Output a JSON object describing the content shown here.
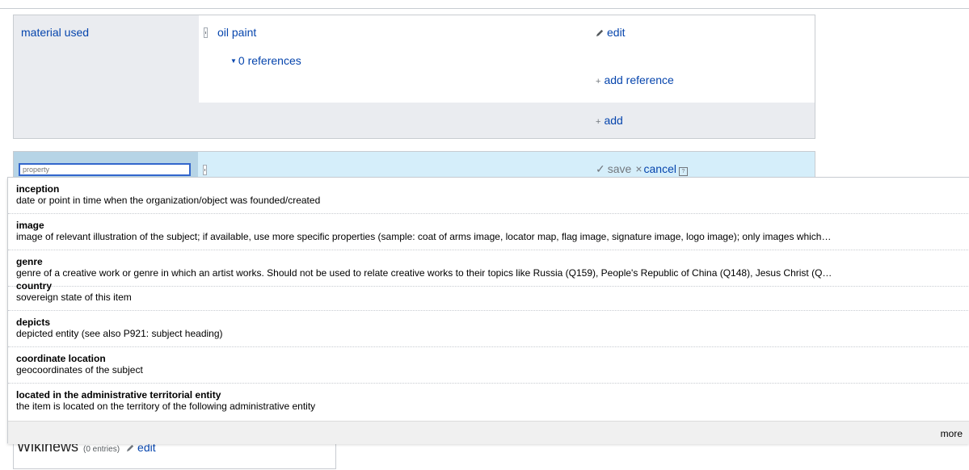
{
  "statement": {
    "property_label": "material used",
    "value": "oil paint",
    "references_toggle": "0 references",
    "edit_label": "edit",
    "add_reference_label": "add reference",
    "add_label": "add"
  },
  "new_statement": {
    "property_placeholder": "property",
    "save_label": "save",
    "cancel_label": "cancel",
    "help_glyph": "?"
  },
  "suggestions": [
    {
      "label": "inception",
      "description": "date or point in time when the organization/object was founded/created"
    },
    {
      "label": "image",
      "description": "image of relevant illustration of the subject; if available, use more specific properties (sample: coat of arms image, locator map, flag image, signature image, logo image); only images which…"
    },
    {
      "label": "genre",
      "description": "genre of a creative work or genre in which an artist works. Should not be used to relate creative works to their topics like Russia (Q159), People's Republic of China (Q148), Jesus Christ (Q…"
    },
    {
      "label": "country",
      "description": "sovereign state of this item"
    },
    {
      "label": "depicts",
      "description": "depicted entity (see also P921: subject heading)"
    },
    {
      "label": "coordinate location",
      "description": "geocoordinates of the subject"
    },
    {
      "label": "located in the administrative territorial entity",
      "description": "the item is located on the territory of the following administrative entity"
    }
  ],
  "more_label": "more",
  "background": {
    "wikinews_title": "Wikinews",
    "wikinews_count": "(0 entries)",
    "wikinews_edit": "edit"
  },
  "colors": {
    "link": "#0645ad",
    "input_focus": "#3366cc",
    "edit_row": "#d5eefa"
  }
}
